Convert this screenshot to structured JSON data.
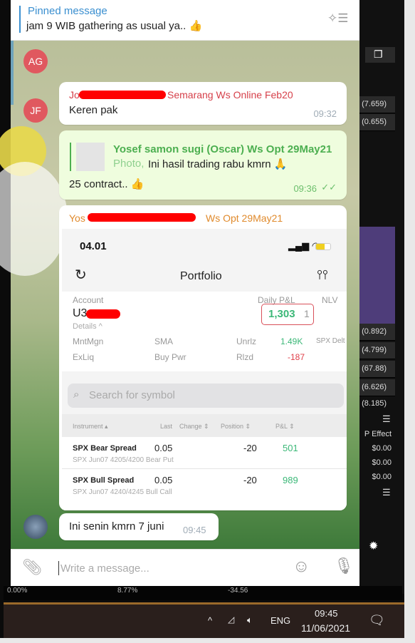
{
  "pinned": {
    "title": "Pinned message",
    "text": "jam  9 WIB gathering as usual ya.. 👍"
  },
  "avatars": {
    "ag": "AG",
    "jf": "JF"
  },
  "messages": [
    {
      "sender": "Jo… Semarang Ws Online Feb20",
      "sender_visible": "Semarang Ws Online Feb20",
      "sender_prefix": "Jo",
      "text": "Keren pak",
      "time": "09:32"
    },
    {
      "reply_to": "Yosef samon sugi (Oscar) Ws Opt 29May21",
      "reply_kind": "Photo,",
      "reply_text": "Ini hasil trading rabu kmrn 🙏",
      "text": "25 contract.. 👍",
      "time": "09:36",
      "read": "✓✓"
    },
    {
      "sender_prefix": "Yos",
      "sender_suffix": "Ws Opt 29May21"
    },
    {
      "text": "Ini senin kmrn 7 juni",
      "time": "09:45"
    }
  ],
  "screenshot": {
    "clock": "04.01",
    "title": "Portfolio",
    "account_label": "Account",
    "account_value": "U3",
    "daily_pnl_label": "Daily P&L",
    "nlv_label": "NLV",
    "daily_pnl": "1,303",
    "daily_pnl_suffix": "1",
    "details": "Details ^",
    "stats": {
      "mntmgn": "MntMgn",
      "sma": "SMA",
      "unrlz": "Unrlz",
      "unrlz_val": "1.49K",
      "spx": "SPX Delt",
      "exliq": "ExLiq",
      "buypwr": "Buy Pwr",
      "rlzd": "Rlzd",
      "rlzd_val": "-187"
    },
    "search_placeholder": "Search for symbol",
    "columns": [
      "Instrument ▴",
      "Last",
      "Change ⇕",
      "Position ⇕",
      "P&L ⇕"
    ],
    "rows": [
      {
        "name": "SPX Bear Spread",
        "desc": "SPX Jun07 4205/4200 Bear Put",
        "last": "0.05",
        "position": "-20",
        "pnl": "501"
      },
      {
        "name": "SPX Bull Spread",
        "desc": "SPX Jun07 4240/4245 Bull Call",
        "last": "0.05",
        "position": "-20",
        "pnl": "989"
      }
    ]
  },
  "input": {
    "placeholder": "Write a message..."
  },
  "background_app": {
    "values": [
      "(7.659)",
      "(0.655)",
      "(0.892)",
      "(4.799)",
      "(67.88)",
      "(6.626)",
      "(8.185)"
    ],
    "effect_header": "P Effect",
    "effects": [
      "$0.00",
      "$0.00",
      "$0.00"
    ],
    "bottom_row": [
      "0.00%",
      "8.77%",
      "-34.56"
    ]
  },
  "taskbar": {
    "lang": "ENG",
    "time": "09:45",
    "date": "11/06/2021"
  },
  "colors": {
    "pinned": "#3a8fd0",
    "sender_red": "#d6404a",
    "sender_green": "#4caf50",
    "sender_orange": "#e08a2c",
    "pnl_green": "#3cb878",
    "loss_red": "#e0404a"
  }
}
